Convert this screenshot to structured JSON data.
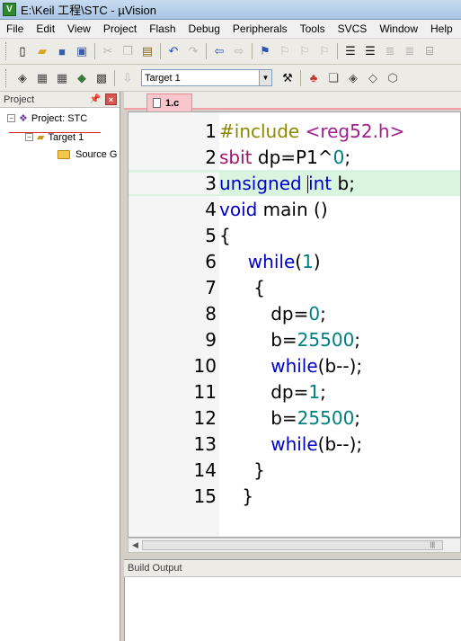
{
  "window": {
    "title": "E:\\Keil 工程\\STC - µVision",
    "icon_label": "V"
  },
  "menu": [
    "File",
    "Edit",
    "View",
    "Project",
    "Flash",
    "Debug",
    "Peripherals",
    "Tools",
    "SVCS",
    "Window",
    "Help"
  ],
  "toolbar": {
    "target_selector": "Target 1"
  },
  "project_panel": {
    "title": "Project",
    "tree": {
      "project": "Project: STC",
      "target": "Target 1",
      "group": "Source G"
    }
  },
  "editor": {
    "tab_label": "1.c",
    "current_line": 3,
    "line_numbers": [
      "1",
      "2",
      "3",
      "4",
      "5",
      "6",
      "7",
      "8",
      "9",
      "10",
      "11",
      "12",
      "13",
      "14",
      "15"
    ]
  },
  "build_output": {
    "title": "Build Output"
  }
}
